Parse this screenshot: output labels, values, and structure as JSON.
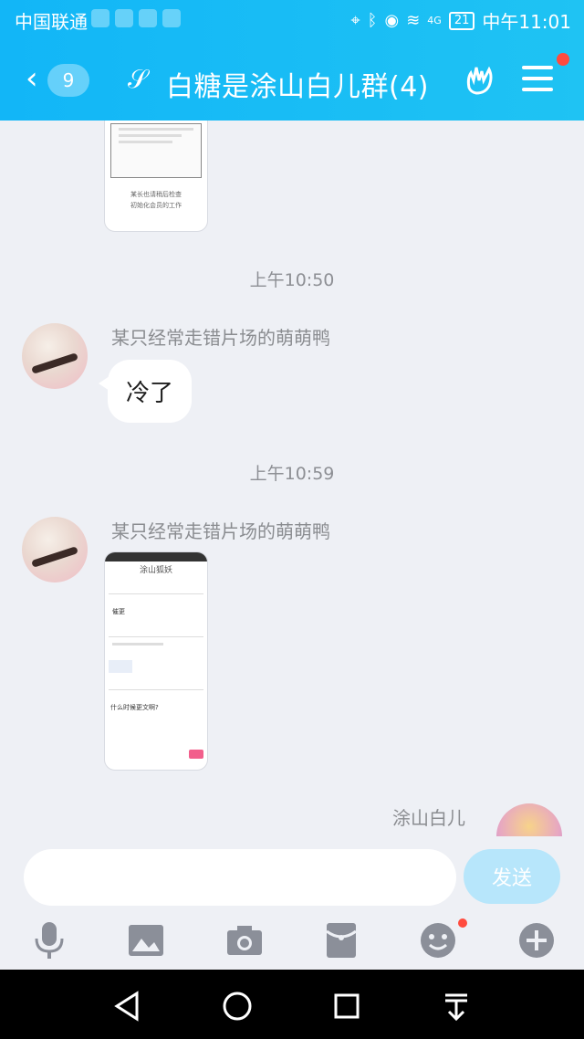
{
  "status": {
    "carrier": "中国联通",
    "net": "4G",
    "battery": "21",
    "time": "中午11:01"
  },
  "header": {
    "back_icon": "chevron-left-icon",
    "unread_count": "9",
    "title": "白糖是涂山白儿群(4)"
  },
  "chat": {
    "messages": [
      {
        "type": "image",
        "caption_lines": [
          "某长也请稍后检查",
          "初始化会员的工作"
        ]
      },
      {
        "type": "time",
        "text": "上午10:50"
      },
      {
        "type": "text",
        "sender": "某只经常走错片场的萌萌鸭",
        "text": "冷了"
      },
      {
        "type": "time",
        "text": "上午10:59"
      },
      {
        "type": "image",
        "sender": "某只经常走错片场的萌萌鸭",
        "caption_lines": [
          "涂山狐妖",
          "催更",
          "什么时候更文啊?"
        ]
      }
    ],
    "self_name": "涂山白儿"
  },
  "input": {
    "placeholder": "",
    "send_label": "发送"
  },
  "toolbar": {
    "icons": [
      "microphone-icon",
      "image-icon",
      "camera-icon",
      "red-packet-icon",
      "emoji-icon",
      "plus-icon"
    ]
  },
  "colors": {
    "header": "#12b6f7",
    "background": "#eef0f5",
    "send_button": "#b7e6fb",
    "notification_dot": "#ff4b3e"
  }
}
